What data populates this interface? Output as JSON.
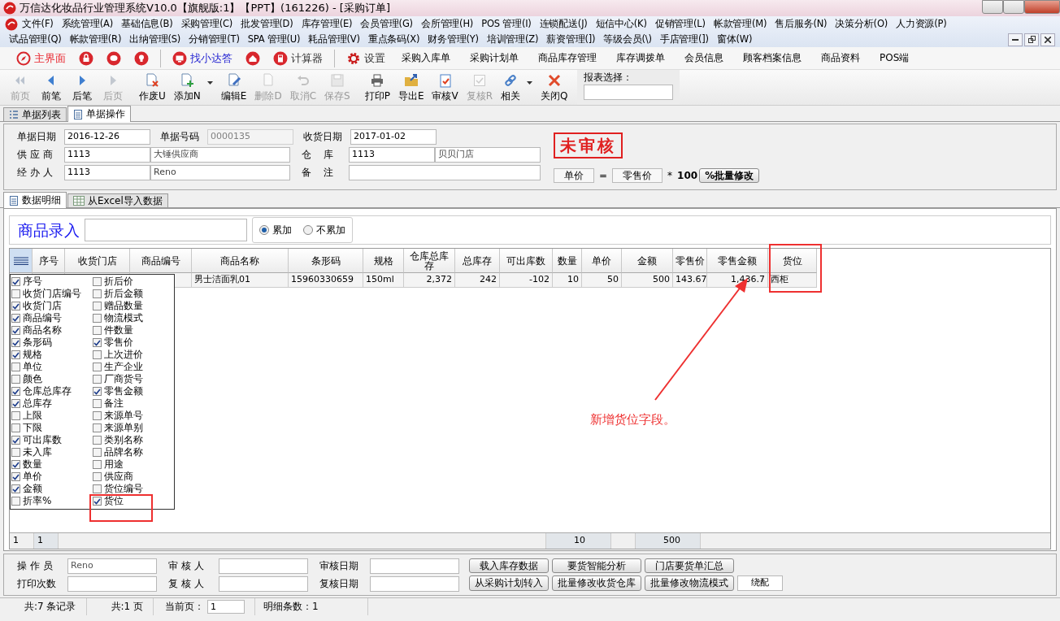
{
  "window": {
    "title": "万信达化妆品行业管理系统V10.0【旗舰版:1】【PPT】(161226) - [采购订单]"
  },
  "menu_bar": {
    "rows": [
      [
        "文件(F)",
        "系统管理(A)",
        "基础信息(B)",
        "采购管理(C)",
        "批发管理(D)",
        "库存管理(E)",
        "会员管理(G)",
        "会所管理(H)",
        "POS 管理(I)",
        "连锁配送(J)",
        "短信中心(K)",
        "促销管理(L)",
        "帐款管理(M)",
        "售后服务(N)",
        "决策分析(O)",
        "人力资源(P)"
      ],
      [
        "试品管理(Q)",
        "帐款管理(R)",
        "出纳管理(S)",
        "分销管理(T)",
        "SPA 管理(U)",
        "耗品管理(V)",
        "重点条码(X)",
        "财务管理(Y)",
        "培训管理(Z)",
        "薪资管理(])",
        "等级会员(\\)",
        "手店管理(])",
        "窗体(W)"
      ]
    ]
  },
  "quick_bar": {
    "items": [
      {
        "label": "主界面",
        "kind": "home"
      },
      {
        "label": "找小达答",
        "kind": "help"
      },
      {
        "label": "计算器",
        "kind": "tool"
      },
      {
        "label": "设置",
        "kind": "tool"
      }
    ],
    "links": [
      "采购入库单",
      "采购计划单",
      "商品库存管理",
      "库存调拨单",
      "会员信息",
      "顾客档案信息",
      "商品资料",
      "POS端"
    ]
  },
  "toolbar": {
    "buttons": [
      {
        "label": "前页",
        "disabled": true,
        "dropdown": false
      },
      {
        "label": "前笔",
        "disabled": false,
        "dropdown": false
      },
      {
        "label": "后笔",
        "disabled": false,
        "dropdown": false
      },
      {
        "label": "后页",
        "disabled": true,
        "dropdown": false
      },
      {
        "label": "作废U",
        "disabled": false,
        "dropdown": false
      },
      {
        "label": "添加N",
        "disabled": false,
        "dropdown": true
      },
      {
        "label": "编辑E",
        "disabled": false,
        "dropdown": false
      },
      {
        "label": "删除D",
        "disabled": true,
        "dropdown": false
      },
      {
        "label": "取消C",
        "disabled": true,
        "dropdown": false
      },
      {
        "label": "保存S",
        "disabled": true,
        "dropdown": false
      },
      {
        "label": "打印P",
        "disabled": false,
        "dropdown": false
      },
      {
        "label": "导出E",
        "disabled": false,
        "dropdown": false
      },
      {
        "label": "审核V",
        "disabled": false,
        "dropdown": false
      },
      {
        "label": "复核R",
        "disabled": true,
        "dropdown": false
      },
      {
        "label": "相关",
        "disabled": false,
        "dropdown": true
      },
      {
        "label": "关闭Q",
        "disabled": false,
        "dropdown": false
      }
    ],
    "report_select": {
      "label": "报表选择："
    }
  },
  "doc_tabs": [
    {
      "label": "单据列表",
      "selected": false
    },
    {
      "label": "单据操作",
      "selected": true
    }
  ],
  "form": {
    "rows": [
      [
        {
          "kind": "single",
          "label": "单据日期",
          "value": "2016-12-26",
          "disabled": false
        },
        {
          "kind": "single",
          "label": "单据号码",
          "value": "0000135",
          "disabled": true
        },
        {
          "kind": "single",
          "label": "收货日期",
          "value": "2017-01-02",
          "disabled": false
        }
      ],
      [
        {
          "kind": "pair",
          "label": "供 应 商",
          "value": "1113",
          "extra": "大锤供应商",
          "disabled": false
        },
        {
          "kind": "pair",
          "label": "仓    库",
          "value": "1113",
          "extra": "贝贝门店",
          "disabled": false
        }
      ],
      [
        {
          "kind": "pair",
          "label": "经 办 人",
          "value": "1113",
          "extra": "Reno",
          "disabled": false
        },
        {
          "kind": "note",
          "label": "备    注",
          "disabled": false
        }
      ]
    ],
    "stamp": "未审核",
    "price_formula": {
      "left": "单价",
      "equals": "=",
      "right": "零售价",
      "times": "*",
      "factor": "100",
      "button": "%批量修改"
    }
  },
  "sub_tabs": [
    {
      "label": "数据明细",
      "selected": true
    },
    {
      "label": "从Excel导入数据",
      "selected": false
    }
  ],
  "entry": {
    "label": "商品录入",
    "options": [
      {
        "label": "累加",
        "selected": true
      },
      {
        "label": "不累加",
        "selected": false
      }
    ]
  },
  "grid": {
    "columns": [
      "序号",
      "收货门店",
      "商品编号",
      "商品名称",
      "条形码",
      "规格",
      "仓库总库存",
      "总库存",
      "可出库数",
      "数量",
      "单价",
      "金额",
      "零售价",
      "零售金额",
      "货位"
    ],
    "rows": [
      {
        "cells": [
          "",
          "",
          "",
          "男士洁面乳01",
          "15960330659",
          "150ml",
          "2,372",
          "242",
          "-102",
          "10",
          "50",
          "500",
          "143.67",
          "1,436.7",
          "西柜"
        ]
      }
    ],
    "column_chooser": [
      [
        {
          "label": "序号",
          "checked": true
        },
        {
          "label": "收货门店编号",
          "checked": false
        },
        {
          "label": "收货门店",
          "checked": true
        },
        {
          "label": "商品编号",
          "checked": true
        },
        {
          "label": "商品名称",
          "checked": true
        },
        {
          "label": "条形码",
          "checked": true
        },
        {
          "label": "规格",
          "checked": true
        },
        {
          "label": "单位",
          "checked": false
        },
        {
          "label": "颜色",
          "checked": false
        },
        {
          "label": "仓库总库存",
          "checked": true
        },
        {
          "label": "总库存",
          "checked": true
        },
        {
          "label": "上限",
          "checked": false
        },
        {
          "label": "下限",
          "checked": false
        },
        {
          "label": "可出库数",
          "checked": true
        },
        {
          "label": "未入库",
          "checked": false
        },
        {
          "label": "数量",
          "checked": true
        },
        {
          "label": "单价",
          "checked": true
        },
        {
          "label": "金额",
          "checked": true
        },
        {
          "label": "折率%",
          "checked": false
        }
      ],
      [
        {
          "label": "折后价",
          "checked": false
        },
        {
          "label": "折后金额",
          "checked": false
        },
        {
          "label": "赠品数量",
          "checked": false
        },
        {
          "label": "物流模式",
          "checked": false
        },
        {
          "label": "件数量",
          "checked": false
        },
        {
          "label": "零售价",
          "checked": true
        },
        {
          "label": "上次进价",
          "checked": false
        },
        {
          "label": "生产企业",
          "checked": false
        },
        {
          "label": "厂商货号",
          "checked": false
        },
        {
          "label": "零售金额",
          "checked": true
        },
        {
          "label": "备注",
          "checked": false
        },
        {
          "label": "来源单号",
          "checked": false
        },
        {
          "label": "来源单别",
          "checked": false
        },
        {
          "label": "类别名称",
          "checked": false
        },
        {
          "label": "品牌名称",
          "checked": false
        },
        {
          "label": "用途",
          "checked": false
        },
        {
          "label": "供应商",
          "checked": false
        },
        {
          "label": "货位编号",
          "checked": false
        },
        {
          "label": "货位",
          "checked": true
        }
      ]
    ],
    "annotation": {
      "text": "新增货位字段。"
    },
    "footer": {
      "row_number": "1",
      "count": "1",
      "quantity": "10",
      "amount": "500"
    }
  },
  "bottom_form": {
    "fields": [
      {
        "label": "操 作 员",
        "value": "Reno"
      },
      {
        "label": "审 核 人"
      },
      {
        "label": "审核日期"
      },
      {
        "label": "打印次数"
      },
      {
        "label": "复 核 人"
      },
      {
        "label": "复核日期"
      }
    ],
    "buttons": [
      "载入库存数据",
      "要货智能分析",
      "门店要货单汇总",
      "从采购计划转入",
      "批量修改收货仓库",
      "批量修改物流模式"
    ],
    "mode": "绕配"
  },
  "status_bar": {
    "records": "共:7 条记录",
    "pages": "共:1 页",
    "current_label": "当前页：",
    "current": "1",
    "details": "明细条数：1"
  }
}
